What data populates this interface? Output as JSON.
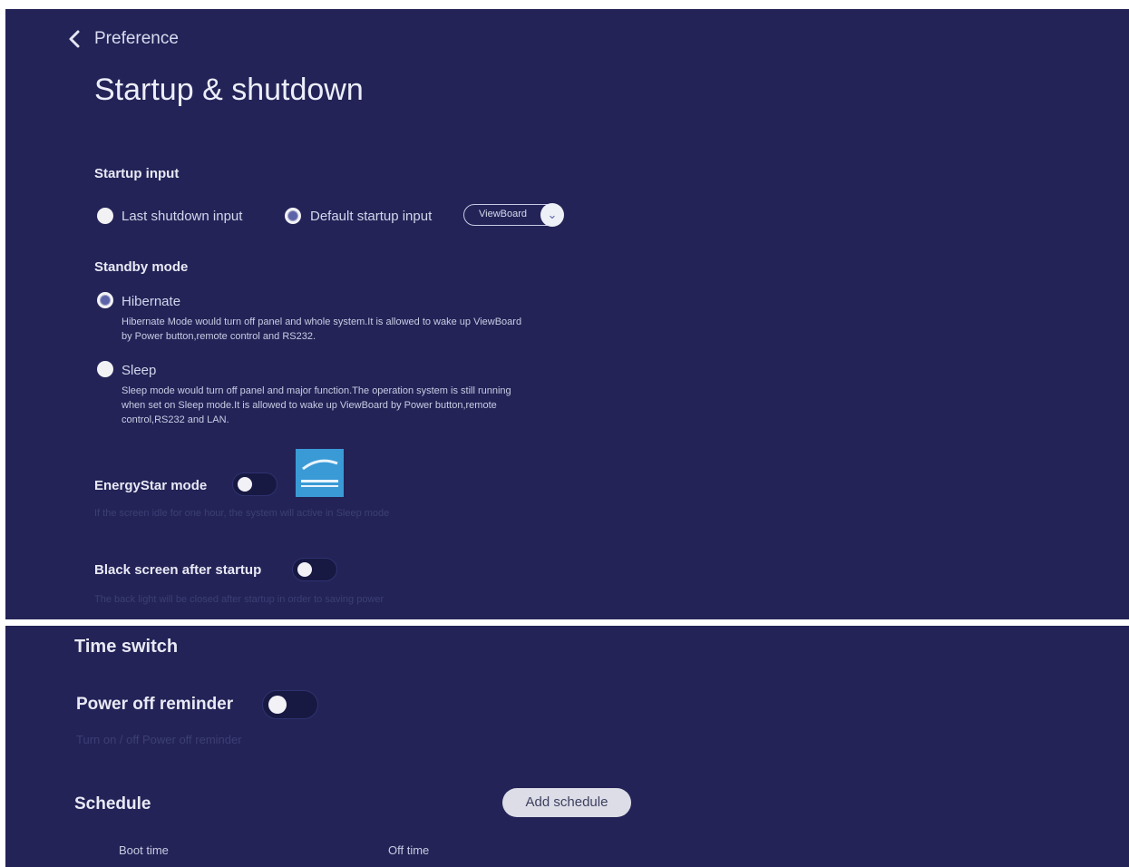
{
  "header": {
    "breadcrumb": "Preference",
    "title": "Startup & shutdown"
  },
  "startup_input": {
    "label": "Startup input",
    "options": [
      "Last shutdown input",
      "Default startup input"
    ],
    "selected_index": 1,
    "dropdown_value": "ViewBoard"
  },
  "standby_mode": {
    "label": "Standby mode",
    "options": [
      {
        "label": "Hibernate",
        "selected": true,
        "desc": "Hibernate Mode would turn off panel and whole system.It is allowed to wake up ViewBoard by Power button,remote control and RS232."
      },
      {
        "label": "Sleep",
        "selected": false,
        "desc": "Sleep mode would turn off panel and major function.The operation system is still running when set on Sleep mode.It is allowed to wake up ViewBoard by Power button,remote control,RS232 and LAN."
      }
    ]
  },
  "energystar": {
    "label": "EnergyStar mode",
    "enabled": false,
    "hint": "If the screen idle for one hour, the system will active in Sleep mode"
  },
  "black_screen": {
    "label": "Black screen after startup",
    "enabled": false,
    "hint": "The back light will be closed after startup in order to saving power"
  },
  "time_switch": {
    "label": "Time switch",
    "power_off_reminder": {
      "label": "Power off reminder",
      "enabled": false,
      "hint": "Turn on / off Power off reminder"
    },
    "schedule": {
      "label": "Schedule",
      "add_label": "Add schedule",
      "columns": [
        "Boot time",
        "Off time"
      ]
    }
  },
  "colors": {
    "background": "#232357",
    "accent": "#5c63a8",
    "page_outer": "#ffffff"
  },
  "icons": {
    "back": "chevron-left-icon",
    "dropdown": "chevron-down-icon",
    "energystar": "energystar-logo-icon"
  }
}
